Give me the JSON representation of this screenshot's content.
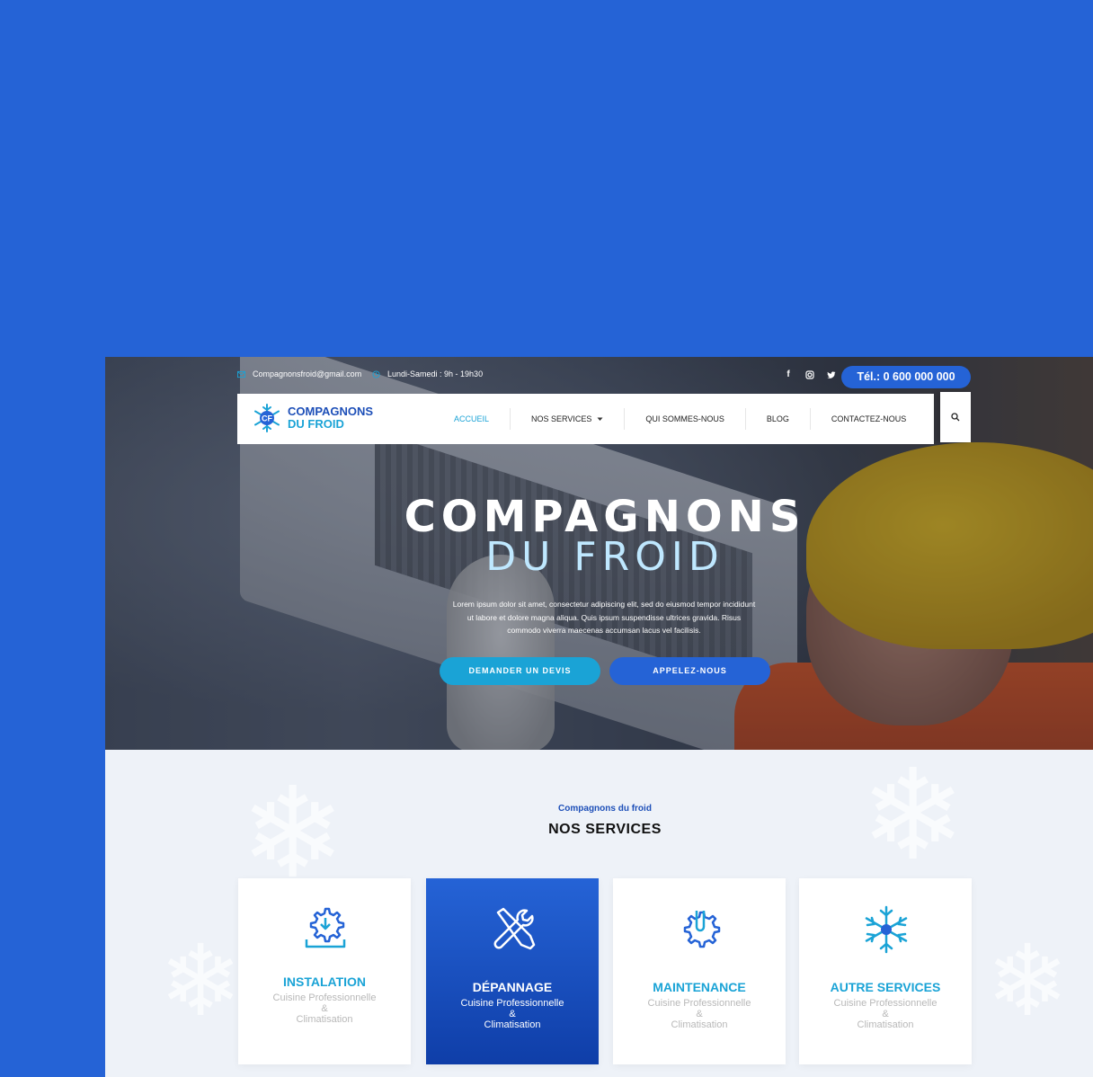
{
  "topbar": {
    "email": "Compagnonsfroid@gmail.com",
    "hours": "Lundi-Samedi : 9h - 19h30",
    "socials": [
      "facebook-icon",
      "instagram-icon",
      "twitter-icon"
    ],
    "tel": "Tél.: 0 600 000 000"
  },
  "logo": {
    "line1": "COMPAGNONS",
    "line2": "DU FROID",
    "badge": "CF"
  },
  "nav": {
    "items": [
      "ACCUEIL",
      "NOS SERVICES",
      "QUI SOMMES-NOUS",
      "BLOG",
      "CONTACTEZ-NOUS"
    ],
    "active": "ACCUEIL"
  },
  "hero": {
    "title1": "COMPAGNONS",
    "title2": "DU FROID",
    "description": "Lorem ipsum dolor sit amet, consectetur adipiscing elit, sed do eiusmod tempor incididunt ut labore et dolore magna aliqua. Quis ipsum suspendisse ultrices gravida. Risus commodo viverra maecenas accumsan lacus vel facilisis.",
    "btn_devis": "DEMANDER UN DEVIS",
    "btn_appel": "APPELEZ-NOUS"
  },
  "services": {
    "subtitle": "Compagnons du froid",
    "title": "NOS SERVICES",
    "cards": [
      {
        "title": "INSTALATION",
        "line1": "Cuisine Professionnelle",
        "line2": "&",
        "line3": "Climatisation"
      },
      {
        "title": "DÉPANNAGE",
        "line1": "Cuisine Professionnelle",
        "line2": "&",
        "line3": "Climatisation"
      },
      {
        "title": "MAINTENANCE",
        "line1": "Cuisine Professionnelle",
        "line2": "&",
        "line3": "Climatisation"
      },
      {
        "title": "AUTRE  SERVICES",
        "line1": "Cuisine Professionnelle",
        "line2": "&",
        "line3": "Climatisation"
      }
    ]
  },
  "colors": {
    "brand": "#2563d6",
    "accent": "#1aa3d6",
    "navy": "#1d4fb8"
  }
}
